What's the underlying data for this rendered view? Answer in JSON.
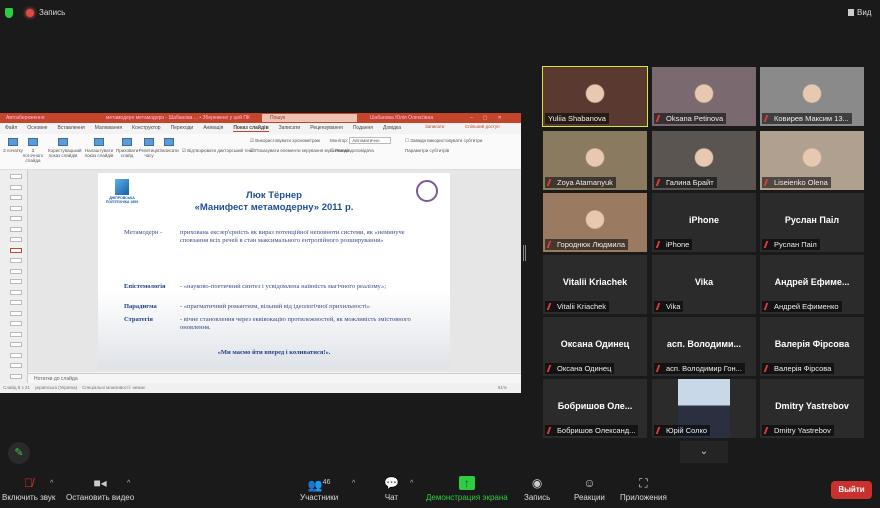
{
  "topbar": {
    "recording_label": "Запись",
    "view_label": "Вид"
  },
  "ppt": {
    "autosave": "Автозбереження",
    "doc_title": "метамодерн метамодерн - Шабанова ... • Збережено у цей ПК",
    "search_placeholder": "Пошук",
    "user": "Шабанова Юлія Олексіївна",
    "menu": [
      "Файл",
      "Основне",
      "Вставлення",
      "Малювання",
      "Конструктор",
      "Переходи",
      "Анімація",
      "Показ слайдів",
      "Записати",
      "Рецензування",
      "Подання",
      "Довідка"
    ],
    "share": "Спільний доступ",
    "record": "Записати",
    "ribbon": [
      "З початку",
      "З поточного слайда",
      "Користувацький показ слайдів",
      "Налаштувати показ слайдів",
      "Приховати слайд",
      "Репетиція часу",
      "Записати"
    ],
    "checks": [
      "Відтворювати дикторський текст",
      "Використовувати хронометраж",
      "Показувати елементи керування мультимедіа"
    ],
    "monitor_label": "Монітор:",
    "monitor_value": "Автоматично",
    "presenter_mode": "Режим доповідача",
    "subtitles": "Завжди використовувати субтитри",
    "subtitle_settings": "Параметри субтитрів",
    "notes": "Нотатки до слайда",
    "status_slide": "Слайд 8 з 21",
    "status_lang": "українська (Україна)",
    "status_access": "Спеціальні можливості: немає",
    "zoom_pct": "61%"
  },
  "slide": {
    "logo_text": "ДНІПРОВСЬКА ПОЛІТЕХНІКА 1899",
    "title1": "Люк Тёрнер",
    "title2": "«Манифест метамодерну»  2011 р.",
    "t1_label": "Метамодерн -",
    "t1_text": "прихована ексзер'єрність як вираз потенційної неповноти системи, як «неминуче сповзання всіх речей в стан максимального ентропійного розширування»",
    "t2_label": "Епістемологія",
    "t2_text": "- «науково-поетичний синтез і усвідомлена наївність магічного реалізму»;",
    "t3_label": "Парадигма",
    "t3_text": "- «прагматичний романтизм, вільний від ідеологічної прихильності»",
    "t4_label": "Стратегія",
    "t4_text": "- вічне становлення через еквівокацію протилежностей, як можливість змістовного оновлення.",
    "quote": "«Ми маємо йти вперед і коливатися!»."
  },
  "participants": [
    {
      "name": "Yuliia Shabanova",
      "video": true,
      "color": "#5a3a30",
      "active": true
    },
    {
      "name": "Oksana Petinova",
      "video": true,
      "color": "#7a6a70"
    },
    {
      "name": "Ковирев Максим 13...",
      "video": true,
      "color": "#8a8a8a"
    },
    {
      "name": "Zoya Atamanyuk",
      "video": true,
      "color": "#8a7a60"
    },
    {
      "name": "Галина Брайт",
      "video": true,
      "color": "#5a5550"
    },
    {
      "name": "Liseienko Olena",
      "video": true,
      "color": "#b0a090"
    },
    {
      "name": "Городнюк Людмила",
      "video": true,
      "color": "#9a7a60"
    },
    {
      "name": "iPhone",
      "big": "iPhone"
    },
    {
      "name": "Руслан Паіл",
      "big": "Руслан Паіл"
    },
    {
      "name": "Vitalii Kriachek",
      "big": "Vitalii Kriachek"
    },
    {
      "name": "Vika",
      "big": "Vika"
    },
    {
      "name": "Андрей Ефименко",
      "big": "Андрей  Ефиме..."
    },
    {
      "name": "Оксана Одинец",
      "big": "Оксана Одинец"
    },
    {
      "name": "асп. Володимир Гон...",
      "big": "асп.  Володими..."
    },
    {
      "name": "Валерія Фірсова",
      "big": "Валерія Фірсова"
    },
    {
      "name": "Бобришов Олександ...",
      "big": "Бобришов  Оле..."
    },
    {
      "name": "Юрій Солко",
      "photo": true
    },
    {
      "name": "Dmitry Yastrebov",
      "big": "Dmitry Yastrebov"
    }
  ],
  "toolbar": {
    "unmute": "Включить звук",
    "video": "Остановить видео",
    "participants": "Участники",
    "participants_count": "46",
    "chat": "Чат",
    "share": "Демонстрация экрана",
    "record": "Запись",
    "reactions": "Реакции",
    "apps": "Приложения",
    "leave": "Выйти"
  },
  "colors": {
    "share": "#2ecc40",
    "leave": "#c8312c",
    "active_speaker": "#d4e83a"
  }
}
